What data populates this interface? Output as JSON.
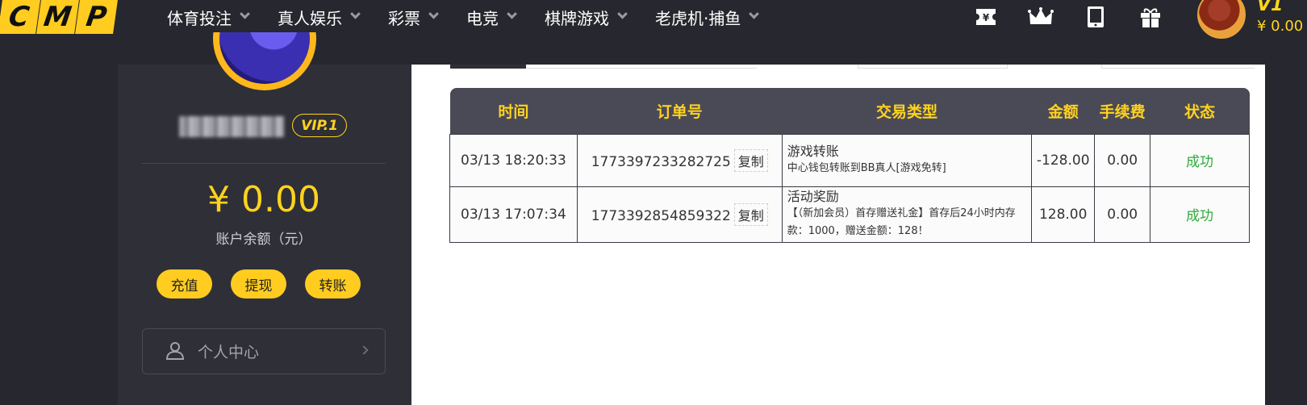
{
  "logo": {
    "letters": [
      "C",
      "M",
      "P"
    ],
    "color": "#ffcc1f"
  },
  "nav": {
    "items": [
      {
        "label": "体育投注"
      },
      {
        "label": "真人娱乐"
      },
      {
        "label": "彩票"
      },
      {
        "label": "电竞"
      },
      {
        "label": "棋牌游戏"
      },
      {
        "label": "老虎机·捕鱼"
      }
    ]
  },
  "header_user": {
    "vip": "V1",
    "balance": "¥ 0.00"
  },
  "header_icons": [
    "ticket-icon",
    "crown-icon",
    "tablet-icon",
    "gift-icon"
  ],
  "sidebar": {
    "vip_badge": "VIP.1",
    "balance": "¥ 0.00",
    "balance_label": "账户余额（元）",
    "buttons": {
      "deposit": "充值",
      "withdraw": "提现",
      "transfer": "转账"
    },
    "menu": {
      "label": "个人中心"
    }
  },
  "table": {
    "headers": [
      "时间",
      "订单号",
      "交易类型",
      "金额",
      "手续费",
      "状态"
    ],
    "copy_label": "复制",
    "rows": [
      {
        "time": "03/13 18:20:33",
        "order": "1773397233282725",
        "type": "游戏转账",
        "type_desc": "中心钱包转账到BB真人[游戏免转]",
        "amount": "-128.00",
        "fee": "0.00",
        "status": "成功"
      },
      {
        "time": "03/13 17:07:34",
        "order": "1773392854859322",
        "type": "活动奖励",
        "type_desc": "【（新加会员）首存赠送礼金】首存后24小时内存款：1000，赠送金额：128！",
        "amount": "128.00",
        "fee": "0.00",
        "status": "成功"
      }
    ]
  },
  "colors": {
    "accent": "#ffcc1f",
    "dark_bg": "#27272f",
    "panel_bg": "#2f2f38",
    "success": "#2eaa3a"
  }
}
